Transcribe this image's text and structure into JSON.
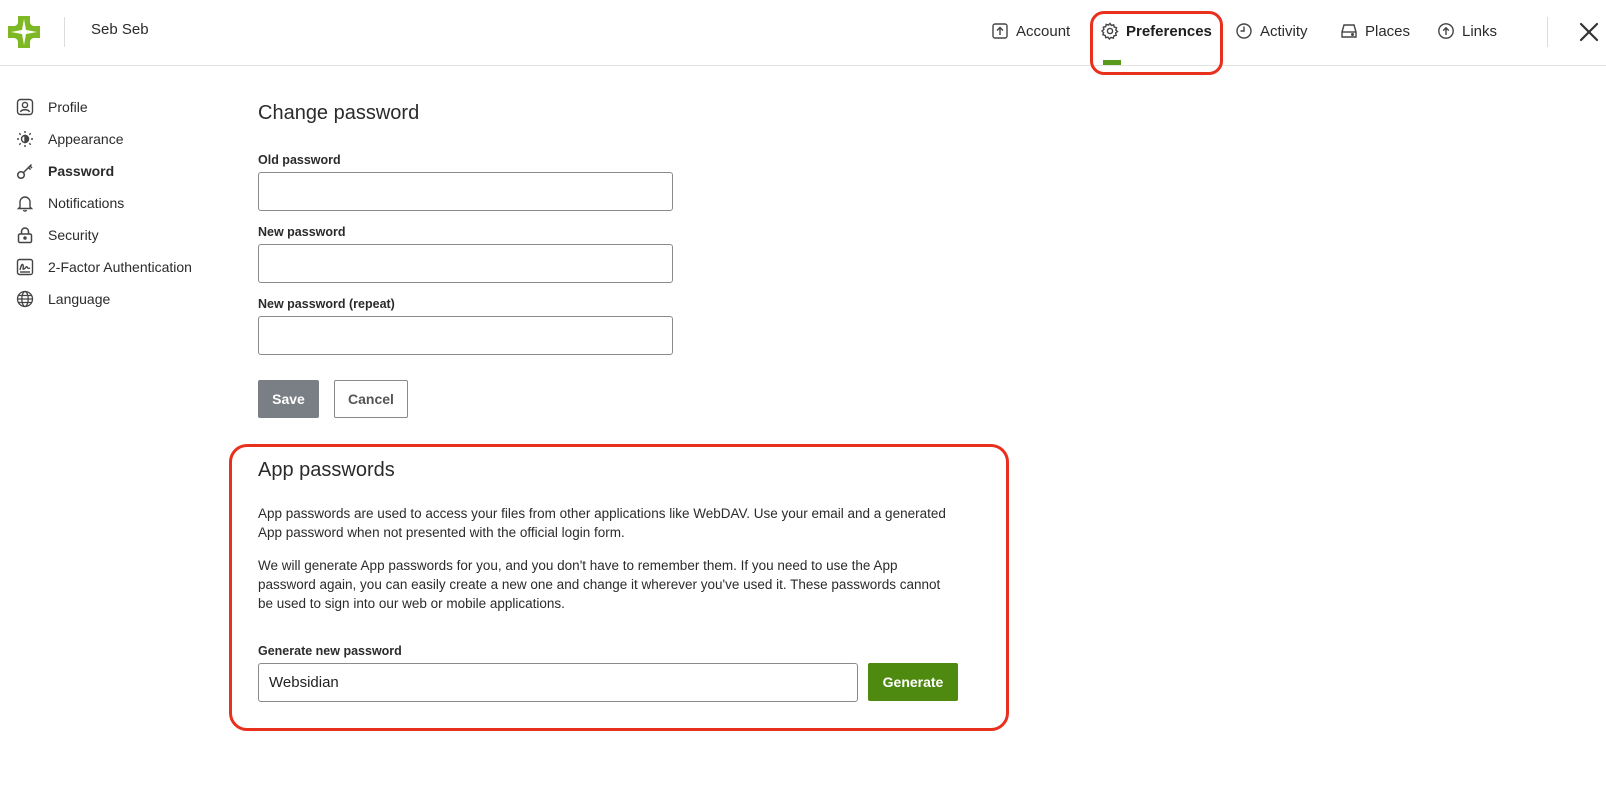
{
  "header": {
    "user_name": "Seb Seb",
    "nav": [
      {
        "label": "Account",
        "icon": "upload-box-icon"
      },
      {
        "label": "Preferences",
        "icon": "gear-icon",
        "active": true
      },
      {
        "label": "Activity",
        "icon": "clock-icon"
      },
      {
        "label": "Places",
        "icon": "hard-drive-icon"
      },
      {
        "label": "Links",
        "icon": "cloud-upload-icon"
      }
    ],
    "close_icon": "close-icon",
    "accent_color": "#5a9a1b"
  },
  "sidebar": {
    "items": [
      {
        "label": "Profile",
        "icon": "user-box-icon"
      },
      {
        "label": "Appearance",
        "icon": "sun-icon"
      },
      {
        "label": "Password",
        "icon": "key-icon",
        "active": true
      },
      {
        "label": "Notifications",
        "icon": "bell-icon"
      },
      {
        "label": "Security",
        "icon": "lock-icon"
      },
      {
        "label": "2-Factor Authentication",
        "icon": "signature-icon"
      },
      {
        "label": "Language",
        "icon": "globe-icon"
      }
    ]
  },
  "change_password": {
    "title": "Change password",
    "old_label": "Old password",
    "old_value": "",
    "new_label": "New password",
    "new_value": "",
    "repeat_label": "New password (repeat)",
    "repeat_value": "",
    "save_label": "Save",
    "cancel_label": "Cancel"
  },
  "app_passwords": {
    "title": "App passwords",
    "para1": "App passwords are used to access your files from other applications like WebDAV. Use your email and a generated App password when not presented with the official login form.",
    "para2": "We will generate App passwords for you, and you don't have to remember them. If you need to use the App password again, you can easily create a new one and change it wherever you've used it. These passwords cannot be used to sign into our web or mobile applications.",
    "generate_label": "Generate new password",
    "generate_value": "Websidian",
    "generate_button": "Generate",
    "button_color": "#4f8a10",
    "highlight_color": "#e8301c"
  }
}
